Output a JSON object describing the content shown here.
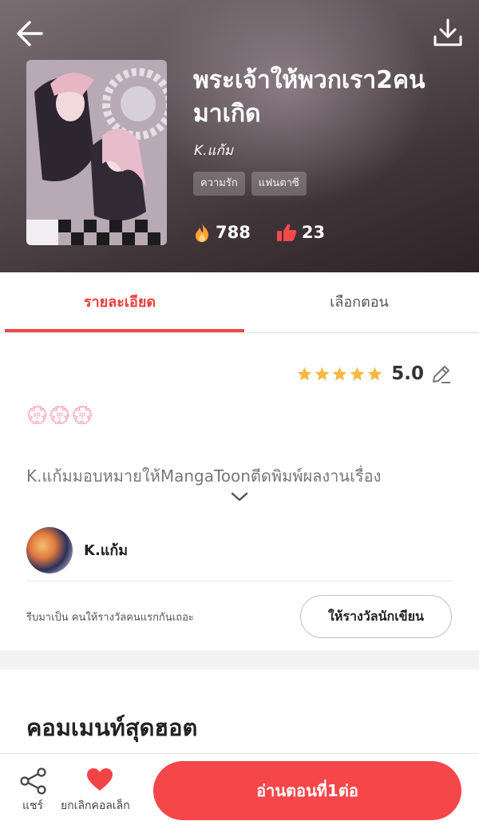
{
  "header": {
    "back_icon": "arrow-left-icon",
    "download_icon": "download-icon",
    "title": "พระเจ้าให้พวกเรา2คนมาเกิด",
    "author": "K.แก้ม",
    "tags": [
      "ความรัก",
      "แฟนตาซี"
    ],
    "views": "788",
    "likes": "23"
  },
  "tabs": [
    {
      "label": "รายละเอียด",
      "active": true
    },
    {
      "label": "เลือกตอน",
      "active": false
    }
  ],
  "detail": {
    "rating_value": "5.0",
    "stars": 5,
    "flowers": "💮💮💮",
    "description": "K.แก้มมอบหมายให้MangaToonตีดพิมพ์ผลงานเรื่อง",
    "author_name": "K.แก้ม",
    "reward_text": "รีบมาเป็น คนให้รางวัลคนแรกกันเถอะ",
    "reward_button": "ให้รางวัลนักเขียน"
  },
  "comments": {
    "title": "คอมเมนท์สุดฮอต"
  },
  "bottom_bar": {
    "share_label": "แชร์",
    "fav_label": "ยกเลิกคอลเล็ก",
    "read_button": "อ่านตอนที่1ต่อ"
  },
  "colors": {
    "accent": "#f5474a",
    "star": "#f5b942"
  }
}
